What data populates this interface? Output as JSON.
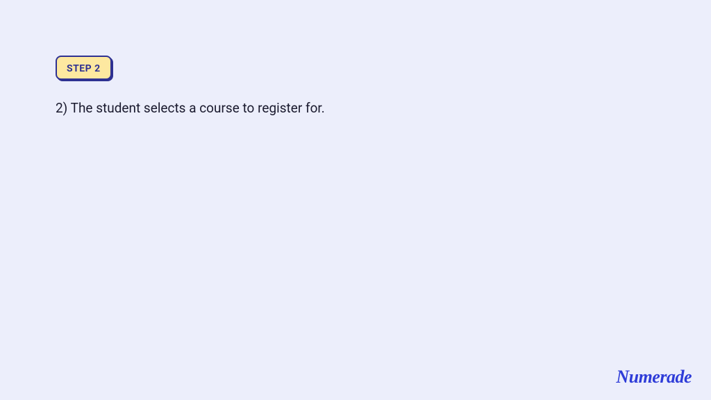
{
  "step": {
    "badge_label": "STEP 2",
    "description": "2) The student selects a course to register for."
  },
  "brand": {
    "name": "Numerade"
  }
}
